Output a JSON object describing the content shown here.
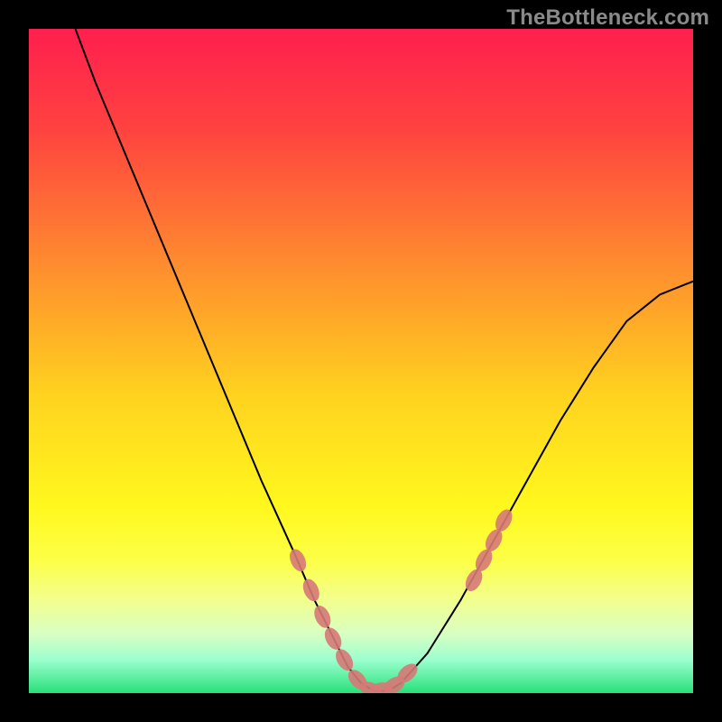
{
  "watermark": "TheBottleneck.com",
  "chart_data": {
    "type": "line",
    "title": "",
    "xlabel": "",
    "ylabel": "",
    "xlim": [
      0,
      100
    ],
    "ylim": [
      0,
      100
    ],
    "grid": false,
    "legend": false,
    "series": [
      {
        "name": "curve",
        "color": "#000000",
        "x": [
          7,
          10,
          15,
          20,
          25,
          30,
          35,
          40,
          43,
          46,
          48,
          50,
          52,
          54,
          56,
          60,
          65,
          70,
          75,
          80,
          85,
          90,
          95,
          100
        ],
        "y": [
          100,
          92,
          80,
          68,
          56,
          44,
          32,
          21,
          14,
          8,
          4,
          1.5,
          0.3,
          0.3,
          1.5,
          6,
          14,
          23,
          32,
          41,
          49,
          56,
          60,
          62
        ]
      },
      {
        "name": "markers-left",
        "type": "scatter",
        "color": "#d67977",
        "x": [
          40.5,
          42.5,
          44.2,
          45.8,
          47.5,
          49.5,
          51.5,
          53.0,
          55.0,
          57.0
        ],
        "y": [
          20.0,
          15.5,
          11.5,
          8.2,
          5.0,
          2.0,
          0.5,
          0.5,
          1.2,
          3.0
        ]
      },
      {
        "name": "markers-right",
        "type": "scatter",
        "color": "#d67977",
        "x": [
          67.0,
          68.5,
          70.0,
          71.5
        ],
        "y": [
          17.0,
          20.0,
          23.0,
          26.0
        ]
      }
    ],
    "background_gradient": {
      "stops": [
        {
          "offset": 0.0,
          "color": "#ff1f4e"
        },
        {
          "offset": 0.15,
          "color": "#ff4240"
        },
        {
          "offset": 0.35,
          "color": "#ff8a2f"
        },
        {
          "offset": 0.55,
          "color": "#ffd21f"
        },
        {
          "offset": 0.72,
          "color": "#fff81e"
        },
        {
          "offset": 0.8,
          "color": "#fdff47"
        },
        {
          "offset": 0.86,
          "color": "#f2ff8e"
        },
        {
          "offset": 0.91,
          "color": "#d9ffc2"
        },
        {
          "offset": 0.95,
          "color": "#9bffcf"
        },
        {
          "offset": 1.0,
          "color": "#27e07a"
        }
      ]
    }
  }
}
